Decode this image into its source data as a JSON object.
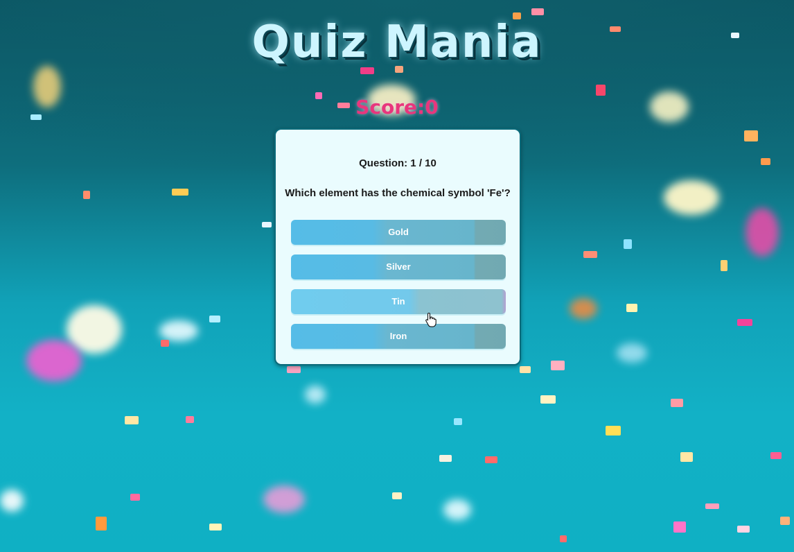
{
  "app": {
    "title": "Quiz Mania",
    "score_label": "Score:",
    "score_value": "0"
  },
  "quiz": {
    "question_label": "Question: 1 / 10",
    "question_text": "Which element has the chemical symbol 'Fe'?",
    "answers": [
      {
        "label": "Gold"
      },
      {
        "label": "Silver"
      },
      {
        "label": "Tin"
      },
      {
        "label": "Iron"
      }
    ]
  },
  "colors": {
    "title": "#cdf5ff",
    "score": "#e8367d",
    "card_bg": "#eafcfe",
    "answer_bg": "#58bbe4"
  },
  "icons": {
    "cursor": "pointer-hand-icon"
  }
}
